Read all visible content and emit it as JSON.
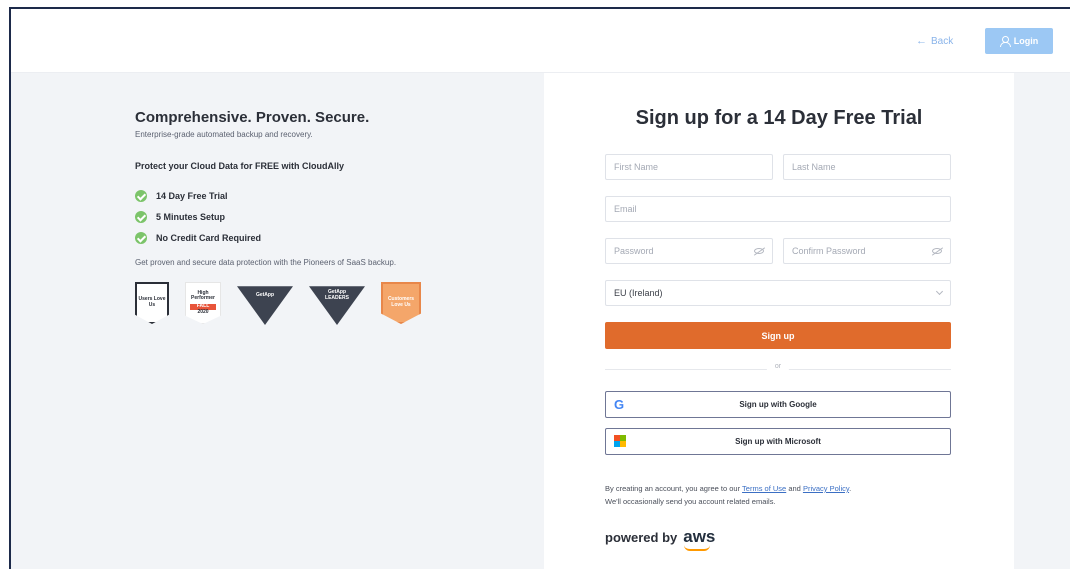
{
  "header": {
    "back_label": "Back",
    "back_arrow": "←",
    "login_label": "Login"
  },
  "left": {
    "headline": "Comprehensive. Proven. Secure.",
    "subline": "Enterprise-grade automated backup and recovery.",
    "protect": "Protect your Cloud Data for FREE with CloudAlly",
    "features": [
      "14 Day Free Trial",
      "5 Minutes Setup",
      "No Credit Card Required"
    ],
    "proven": "Get proven and secure data protection with the Pioneers of SaaS backup.",
    "badges": {
      "users_love_us": "Users Love Us",
      "high_performer": "High Performer",
      "high_performer_tag": "FALL",
      "high_performer_year": "2020",
      "getapp_1": "GetApp",
      "getapp_2": "GetApp",
      "getapp_2_sub": "LEADERS",
      "clutch": "Customers Love Us"
    }
  },
  "form": {
    "title": "Sign up for a 14 Day Free Trial",
    "first_name_placeholder": "First Name",
    "last_name_placeholder": "Last Name",
    "email_placeholder": "Email",
    "password_placeholder": "Password",
    "confirm_password_placeholder": "Confirm Password",
    "region_value": "EU (Ireland)",
    "signup_label": "Sign up",
    "or_label": "or",
    "google_label": "Sign up with Google",
    "microsoft_label": "Sign up with Microsoft",
    "terms_prefix": "By creating an account, you agree to our",
    "terms_link": "Terms of Use",
    "terms_and": "and",
    "privacy_link": "Privacy Policy",
    "terms_suffix": "We'll occasionally send you account related emails.",
    "powered_by": "powered by",
    "aws": "aws"
  },
  "colors": {
    "accent": "#e06b2c",
    "login": "#9cc8f4",
    "check": "#7cc46a"
  }
}
